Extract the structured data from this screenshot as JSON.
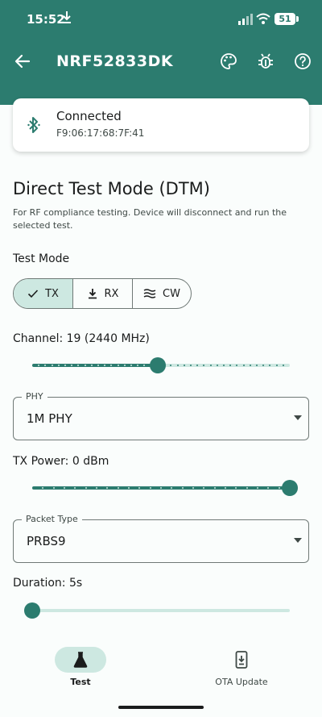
{
  "status": {
    "time": "15:52",
    "battery": "51"
  },
  "appbar": {
    "title": "NRF52833DK",
    "icons": [
      "back-arrow-icon",
      "palette-icon",
      "bug-icon",
      "help-icon"
    ]
  },
  "connection": {
    "status": "Connected",
    "address": "F9:06:17:68:7F:41",
    "icon": "bluetooth-icon"
  },
  "dtm": {
    "title": "Direct Test Mode (DTM)",
    "description": "For RF compliance testing. Device will disconnect and run the selected test.",
    "test_mode": {
      "label": "Test Mode",
      "options": [
        {
          "label": "TX",
          "icon": "check-icon",
          "selected": true
        },
        {
          "label": "RX",
          "icon": "download-icon",
          "selected": false
        },
        {
          "label": "CW",
          "icon": "waves-icon",
          "selected": false
        }
      ]
    },
    "channel": {
      "label": "Channel: 19 (2440 MHz)",
      "value": 19,
      "min": 0,
      "max": 39
    },
    "phy": {
      "label": "PHY",
      "value": "1M PHY"
    },
    "tx_power": {
      "label": "TX Power: 0 dBm",
      "fraction": 1.0
    },
    "packet_type": {
      "label": "Packet Type",
      "value": "PRBS9"
    },
    "duration": {
      "label": "Duration: 5s",
      "fraction": 0.0
    }
  },
  "nav": {
    "items": [
      {
        "label": "Test",
        "icon": "flask-icon",
        "active": true
      },
      {
        "label": "OTA Update",
        "icon": "phone-download-icon",
        "active": false
      }
    ]
  },
  "colors": {
    "primary": "#2c7c6f",
    "primary_container": "#cde8e1",
    "outline": "#6f7976"
  }
}
